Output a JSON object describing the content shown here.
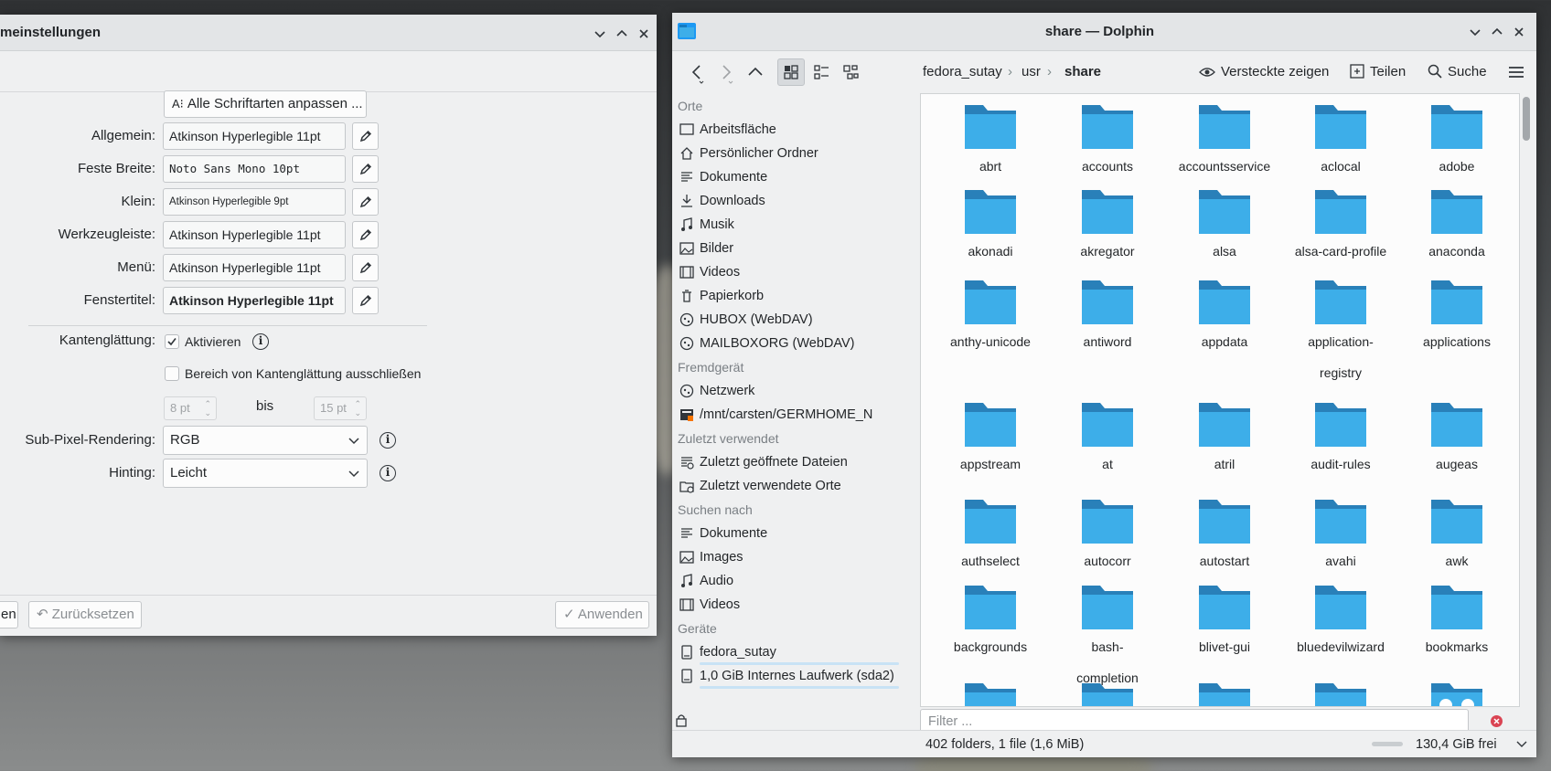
{
  "settings_window": {
    "title": "meinstellungen",
    "adjust_all_button": "Alle Schriftarten anpassen ...",
    "fonts": [
      {
        "label": "Allgemein:",
        "value": "Atkinson Hyperlegible 11pt"
      },
      {
        "label": "Feste Breite:",
        "value": "Noto Sans Mono 10pt"
      },
      {
        "label": "Klein:",
        "value": "Atkinson Hyperlegible 9pt"
      },
      {
        "label": "Werkzeugleiste:",
        "value": "Atkinson Hyperlegible 11pt"
      },
      {
        "label": "Menü:",
        "value": "Atkinson Hyperlegible 11pt"
      },
      {
        "label": "Fenstertitel:",
        "value": "Atkinson Hyperlegible 11pt"
      }
    ],
    "antialias": {
      "label": "Kantenglättung:",
      "enable_label": "Aktivieren",
      "enabled": true,
      "exclude_label": "Bereich von Kantenglättung ausschließen",
      "exclude_enabled": false,
      "from_value": "8 pt",
      "range_word": "bis",
      "to_value": "15 pt"
    },
    "subpixel": {
      "label": "Sub-Pixel-Rendering:",
      "value": "RGB"
    },
    "hinting": {
      "label": "Hinting:",
      "value": "Leicht"
    },
    "bottom": {
      "left_partial": "en",
      "reset_label": "Zurücksetzen",
      "apply_label": "Anwenden"
    }
  },
  "dolphin": {
    "title": "share — Dolphin",
    "breadcrumbs": [
      "fedora_sutay",
      "usr",
      "share"
    ],
    "actions": {
      "hidden": "Versteckte zeigen",
      "share": "Teilen",
      "search": "Suche"
    },
    "places": [
      {
        "type": "head",
        "label": "Orte"
      },
      {
        "type": "item",
        "label": "Arbeitsfläche",
        "icon": "desktop-icon"
      },
      {
        "type": "item",
        "label": "Persönlicher Ordner",
        "icon": "home-icon"
      },
      {
        "type": "item",
        "label": "Dokumente",
        "icon": "documents-icon"
      },
      {
        "type": "item",
        "label": "Downloads",
        "icon": "download-icon"
      },
      {
        "type": "item",
        "label": "Musik",
        "icon": "music-icon"
      },
      {
        "type": "item",
        "label": "Bilder",
        "icon": "pictures-icon"
      },
      {
        "type": "item",
        "label": "Videos",
        "icon": "video-icon"
      },
      {
        "type": "item",
        "label": "Papierkorb",
        "icon": "trash-icon"
      },
      {
        "type": "item",
        "label": "HUBOX (WebDAV)",
        "icon": "network-icon"
      },
      {
        "type": "item",
        "label": "MAILBOXORG (WebDAV)",
        "icon": "network-icon"
      },
      {
        "type": "head",
        "label": "Fremdgerät"
      },
      {
        "type": "item",
        "label": "Netzwerk",
        "icon": "network-icon"
      },
      {
        "type": "item",
        "label": "/mnt/carsten/GERMHOME_N",
        "icon": "nfs-mount-icon"
      },
      {
        "type": "head",
        "label": "Zuletzt verwendet"
      },
      {
        "type": "item",
        "label": "Zuletzt geöffnete Dateien",
        "icon": "recent-files-icon"
      },
      {
        "type": "item",
        "label": "Zuletzt verwendete Orte",
        "icon": "recent-places-icon"
      },
      {
        "type": "head",
        "label": "Suchen nach"
      },
      {
        "type": "item",
        "label": "Dokumente",
        "icon": "documents-icon"
      },
      {
        "type": "item",
        "label": "Images",
        "icon": "pictures-icon"
      },
      {
        "type": "item",
        "label": "Audio",
        "icon": "music-icon"
      },
      {
        "type": "item",
        "label": "Videos",
        "icon": "video-icon"
      },
      {
        "type": "head",
        "label": "Geräte"
      },
      {
        "type": "item",
        "label": "fedora_sutay",
        "icon": "drive-icon"
      },
      {
        "type": "item",
        "label": "1,0 GiB Internes Laufwerk (sda2)",
        "icon": "drive-icon"
      }
    ],
    "folders": [
      [
        "abrt"
      ],
      [
        "accounts"
      ],
      [
        "accountsservice"
      ],
      [
        "aclocal"
      ],
      [
        "adobe"
      ],
      [
        "akonadi"
      ],
      [
        "akregator"
      ],
      [
        "alsa"
      ],
      [
        "alsa-card-profile"
      ],
      [
        "anaconda"
      ],
      [
        "anthy-unicode"
      ],
      [
        "antiword"
      ],
      [
        "appdata"
      ],
      [
        "application-",
        "registry"
      ],
      [
        "applications"
      ],
      [
        "appstream"
      ],
      [
        "at"
      ],
      [
        "atril"
      ],
      [
        "audit-rules"
      ],
      [
        "augeas"
      ],
      [
        "authselect"
      ],
      [
        "autocorr"
      ],
      [
        "autostart"
      ],
      [
        "avahi"
      ],
      [
        "awk"
      ],
      [
        "backgrounds"
      ],
      [
        "bash-",
        "completion"
      ],
      [
        "blivet-gui"
      ],
      [
        "bluedevilwizard"
      ],
      [
        "bookmarks"
      ]
    ],
    "filter_placeholder": "Filter ...",
    "status": {
      "summary": "402 folders, 1 file (1,6 MiB)",
      "free": "130,4 GiB frei"
    }
  },
  "colors": {
    "folder_front": "#3daee9",
    "folder_back": "#2980b9",
    "accent": "#3daee9"
  }
}
